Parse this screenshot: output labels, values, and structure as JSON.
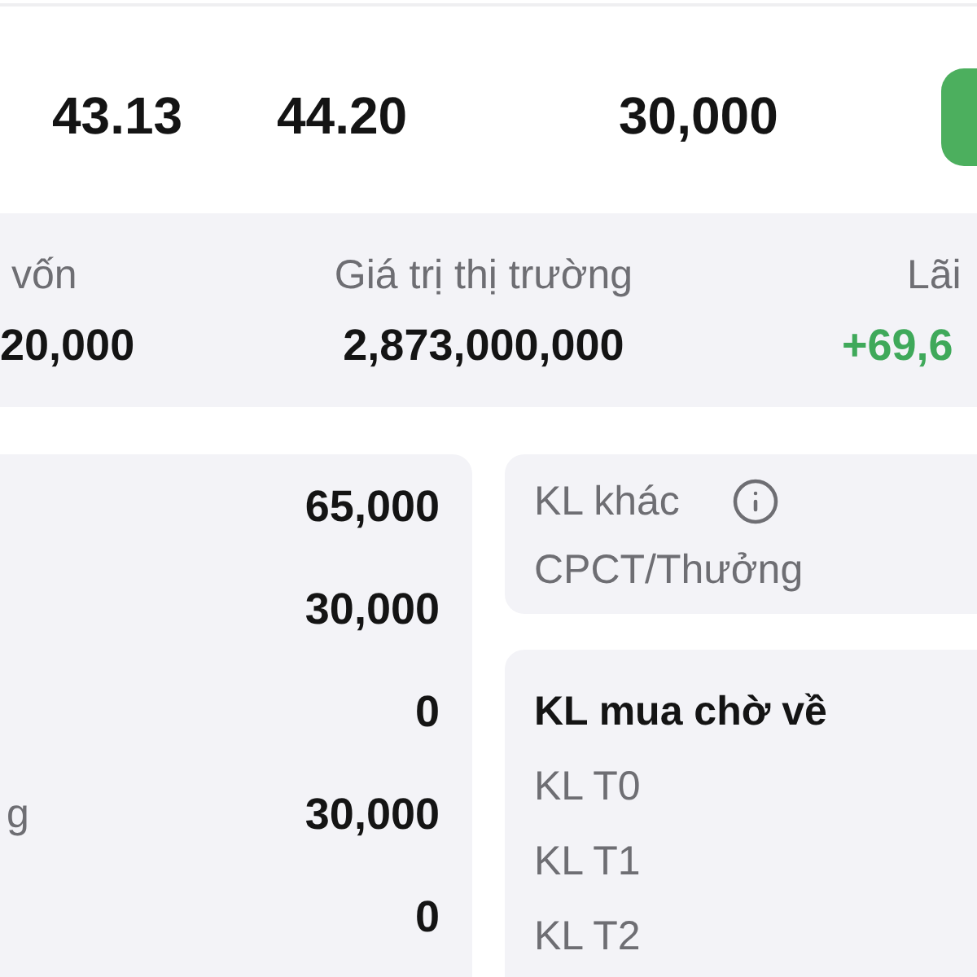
{
  "price_row": {
    "cells": [
      "43.13",
      "44.20",
      "30,000"
    ]
  },
  "summary": {
    "columns": [
      {
        "label": "vốn",
        "value": "20,000",
        "kind": "plain"
      },
      {
        "label": "Giá trị thị trường",
        "value": "2,873,000,000",
        "kind": "plain"
      },
      {
        "label": "Lãi",
        "value": "+69,6",
        "kind": "gain"
      }
    ]
  },
  "volume_card": {
    "rows": [
      {
        "value": "65,000"
      },
      {
        "value": "30,000"
      },
      {
        "value": "0"
      },
      {
        "label": "g",
        "value": "30,000"
      },
      {
        "value": "0"
      }
    ]
  },
  "other_volume_card": {
    "title": "KL khác",
    "subtitle": "CPCT/Thưởng"
  },
  "pending_buy_card": {
    "title": "KL mua chờ về",
    "rows": [
      "KL T0",
      "KL T1",
      "KL T2"
    ]
  }
}
